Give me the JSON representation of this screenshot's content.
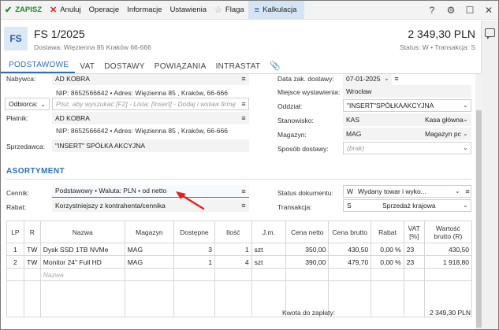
{
  "toolbar": {
    "save": "ZAPISZ",
    "cancel": "Anuluj",
    "operations": "Operacje",
    "info": "Informacje",
    "settings": "Ustawienia",
    "flag": "Flaga",
    "calc": "Kalkulacja"
  },
  "header": {
    "avatar": "FS",
    "title": "FS 1/2025",
    "delivery": "Dostawa: Więzienna 85  Kraków 66-666",
    "amount": "2 349,30 PLN",
    "status": "Status: W • Transakcja: S"
  },
  "tabs": [
    "PODSTAWOWE",
    "VAT",
    "DOSTAWY",
    "POWIĄZANIA",
    "INTRASTAT"
  ],
  "left": {
    "buyer_label": "Nabywca:",
    "buyer_value": "AD KOBRA",
    "buyer_nip": "NIP: 8652566642  •  Adres: Więzienna 85 , Kraków, 66-666",
    "recipient_label": "Odbiorca:",
    "recipient_placeholder": "Pisz, aby wyszukać [F2] - Lista; [Insert] - Dodaj i wstaw firmę",
    "payer_label": "Płatnik:",
    "payer_value": "AD KOBRA",
    "payer_nip": "NIP: 8652566642  •  Adres: Więzienna 85 , Kraków, 66-666",
    "seller_label": "Sprzedawca:",
    "seller_value": "\"INSERT\" SPÓŁKA AKCYJNA"
  },
  "right": {
    "delivery_date_label": "Data zak. dostawy:",
    "delivery_date_value": "07-01-2025",
    "issue_place_label": "Miejsce wystawienia:",
    "issue_place_value": "Wrocław",
    "branch_label": "Oddział:",
    "branch_value": "\"INSERT\"SPÓŁKAAKCYJNA",
    "station_label": "Stanowisko:",
    "station_code": "KAS",
    "station_name": "Kasa główna",
    "warehouse_label": "Magazyn:",
    "warehouse_code": "MAG",
    "warehouse_name": "Magazyn pc",
    "shipping_label": "Sposób dostawy:",
    "shipping_placeholder": "(brak)"
  },
  "assortment": {
    "title": "ASORTYMENT",
    "pricelist_label": "Cennik:",
    "pricelist_value": "Podstawowy • Waluta: PLN • od netto",
    "discount_label": "Rabat:",
    "discount_value": "Korzystniejszy z kontrahenta/cennika",
    "doc_status_label": "Status dokumentu:",
    "doc_status_code": "W",
    "doc_status_name": "Wydany towar i wyko...",
    "transaction_label": "Transakcja:",
    "transaction_code": "S",
    "transaction_name": "Sprzedaż krajowa"
  },
  "grid": {
    "columns": [
      "LP",
      "R",
      "Nazwa",
      "Magazyn",
      "Dostępne",
      "Ilość",
      "J.m.",
      "Cena netto",
      "Cena brutto",
      "Rabat",
      "VAT [%]",
      "Wartość brutto (R)"
    ],
    "rows": [
      [
        "1",
        "TW",
        "Dysk SSD 1TB NVMe",
        "MAG",
        "3",
        "1",
        "szt",
        "350,00",
        "430,50",
        "0,00 %",
        "23",
        "430,50"
      ],
      [
        "2",
        "TW",
        "Monitor 24'' Full HD",
        "MAG",
        "1",
        "4",
        "szt",
        "390,00",
        "479,70",
        "0,00 %",
        "23",
        "1 918,80"
      ]
    ],
    "new_row_placeholder": "Nazwa"
  },
  "footer": {
    "label": "Kwota do zapłaty:",
    "value": "2 349,30 PLN"
  },
  "colors": {
    "accent": "#2d6fb5",
    "save": "#1f8a2e",
    "cancel": "#d32020",
    "arrow": "#e02020"
  }
}
